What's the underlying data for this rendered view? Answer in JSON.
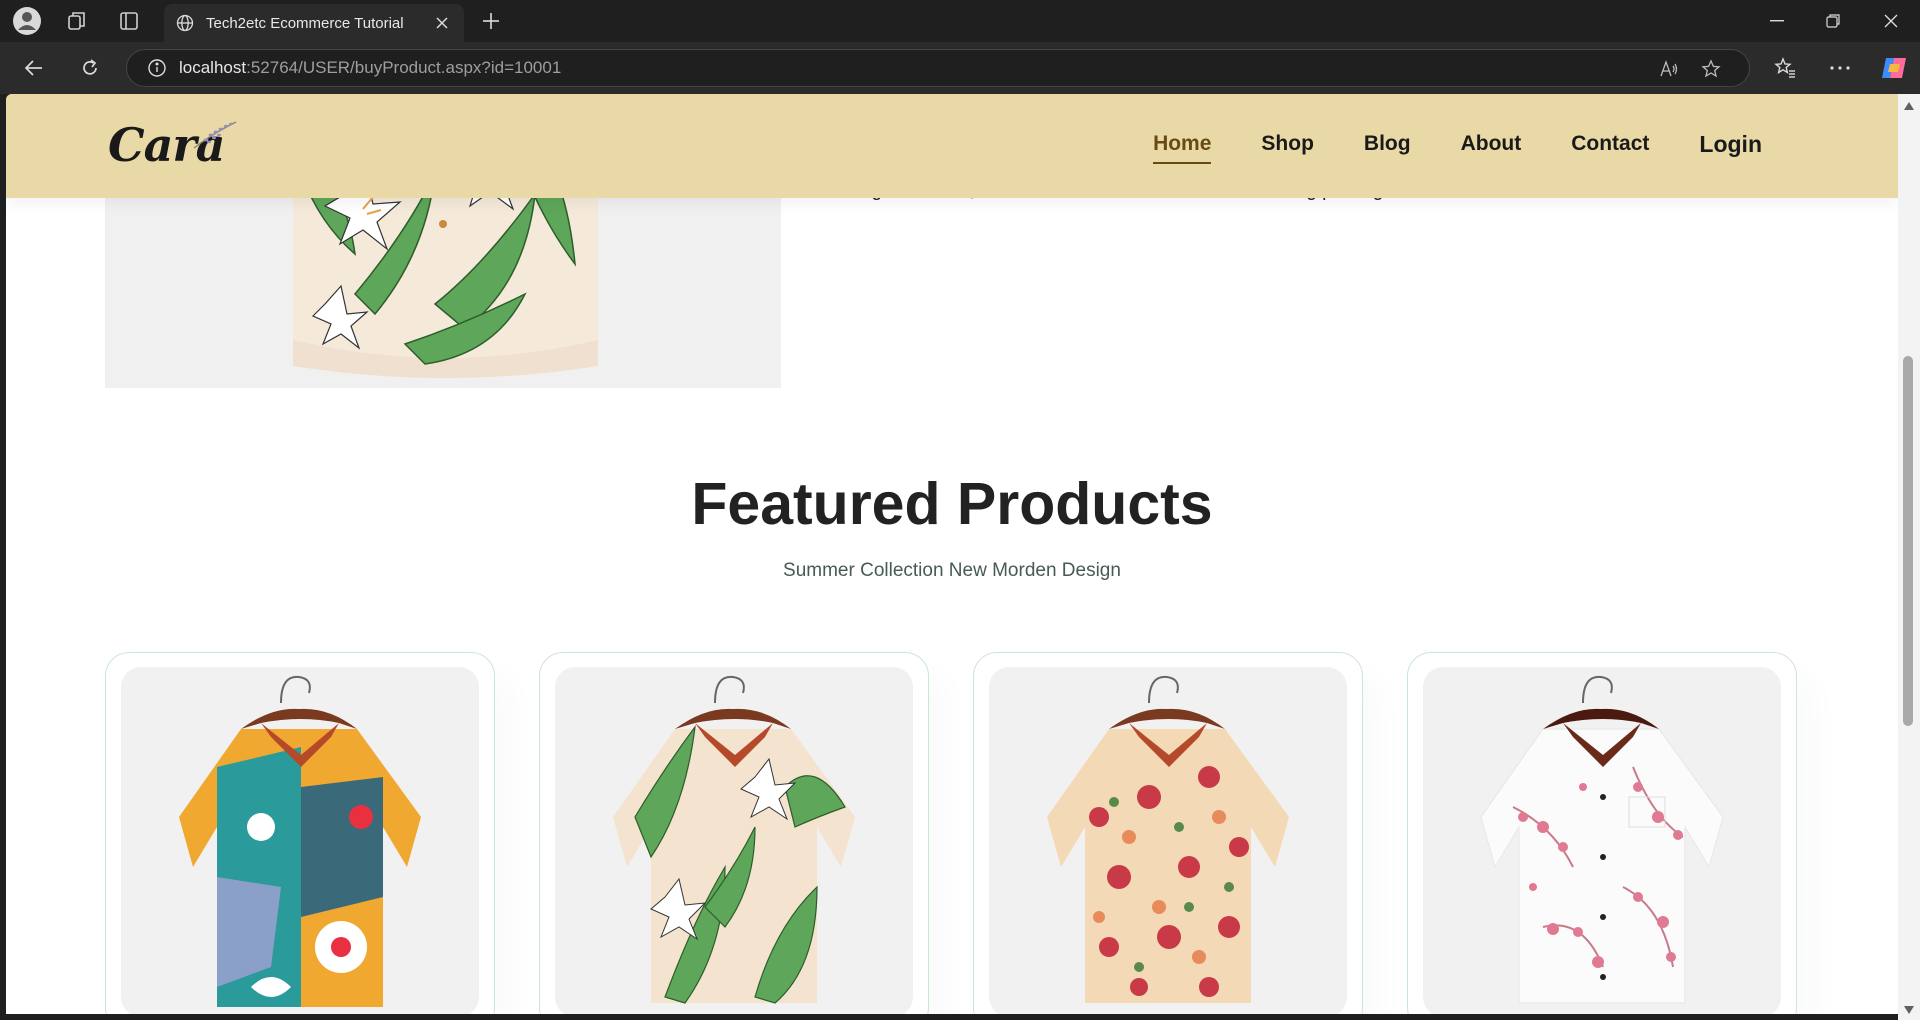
{
  "browser": {
    "tab_title": "Tech2etc Ecommerce Tutorial",
    "url_host": "localhost",
    "url_rest": ":52764/USER/buyProduct.aspx?id=10001"
  },
  "site": {
    "logo": "Cara",
    "nav": [
      {
        "label": "Home",
        "active": true
      },
      {
        "label": "Shop"
      },
      {
        "label": "Blog"
      },
      {
        "label": "About"
      },
      {
        "label": "Contact"
      },
      {
        "label": "Login"
      }
    ],
    "header_bg": "#e8d9a6"
  },
  "detail": {
    "description_tail": "range of colors, it offers it all in the ultimate head-turning package."
  },
  "featured": {
    "title": "Featured Products",
    "subtitle": "Summer Collection New Morden Design"
  },
  "products": [
    {
      "name": "colorful-abstract-shirt"
    },
    {
      "name": "tropical-leaf-shirt"
    },
    {
      "name": "rose-floral-shirt"
    },
    {
      "name": "pink-blossom-shirt"
    }
  ]
}
